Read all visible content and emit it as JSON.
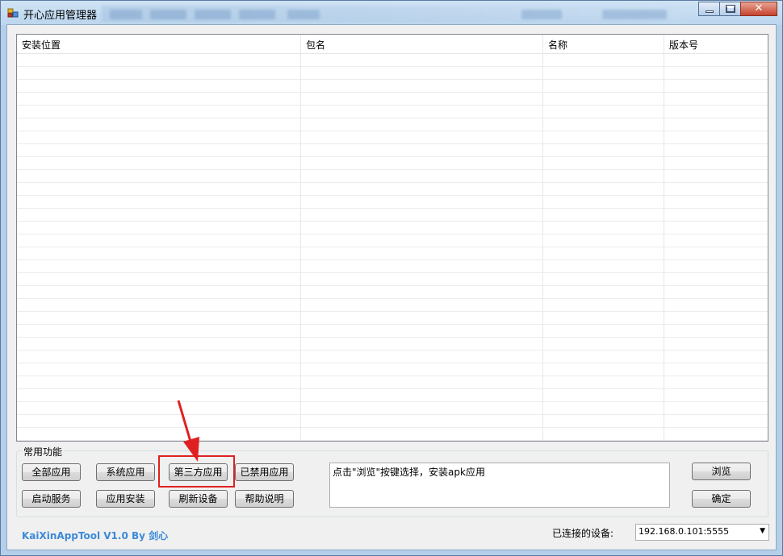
{
  "window": {
    "title": "开心应用管理器",
    "close_glyph": "✕",
    "icon": "app-icon"
  },
  "listview": {
    "columns": [
      "安装位置",
      "包名",
      "名称",
      "版本号"
    ]
  },
  "group": {
    "label": "常用功能",
    "buttons_row1": [
      "全部应用",
      "系统应用",
      "第三方应用",
      "已禁用应用"
    ],
    "buttons_row2": [
      "启动服务",
      "应用安装",
      "刷新设备",
      "帮助说明"
    ]
  },
  "install": {
    "hint_text": "点击\"浏览\"按键选择，安装apk应用",
    "browse_label": "浏览",
    "confirm_label": "确定"
  },
  "footer": {
    "brand": "KaiXinAppTool V1.0 By 剑心",
    "device_label": "已连接的设备:",
    "device_value": "192.168.0.101:5555"
  },
  "colors": {
    "highlight": "#e02020",
    "brand": "#3c8ad8"
  }
}
